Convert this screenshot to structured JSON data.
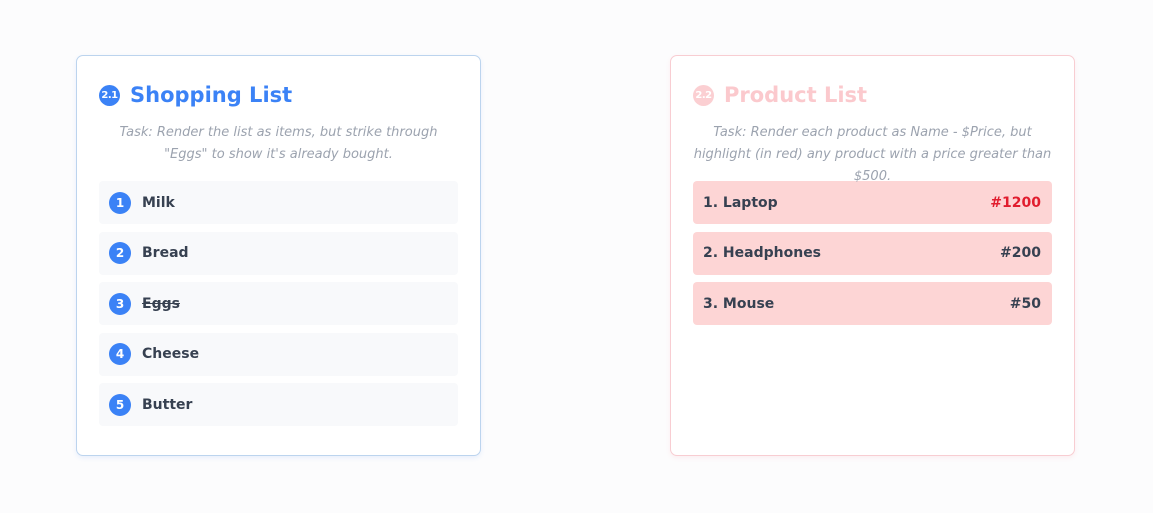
{
  "shopping": {
    "badge": "2.1",
    "title": "Shopping List",
    "task": "Task: Render the list as items, but strike through \"Eggs\" to show it's already bought.",
    "items": [
      {
        "number": "1",
        "label": "Milk",
        "struck": false
      },
      {
        "number": "2",
        "label": "Bread",
        "struck": false
      },
      {
        "number": "3",
        "label": "Eggs",
        "struck": true
      },
      {
        "number": "4",
        "label": "Cheese",
        "struck": false
      },
      {
        "number": "5",
        "label": "Butter",
        "struck": false
      }
    ]
  },
  "products": {
    "badge": "2.2",
    "title": "Product List",
    "task": "Task: Render each product as Name - $Price, but highlight (in red) any product with a price greater than $500.",
    "items": [
      {
        "name": "1. Laptop",
        "price": "#1200",
        "highlight": true
      },
      {
        "name": "2. Headphones",
        "price": "#200",
        "highlight": false
      },
      {
        "name": "3. Mouse",
        "price": "#50",
        "highlight": false
      }
    ]
  },
  "colors": {
    "accent_blue": "#3b82f6",
    "highlight_red": "#e11d2e",
    "product_bg": "#fdd5d5"
  }
}
